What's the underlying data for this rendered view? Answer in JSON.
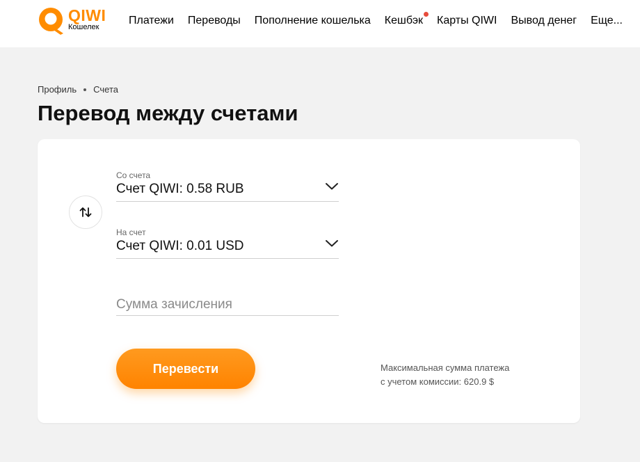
{
  "header": {
    "logo": {
      "brand": "QIWI",
      "subtitle": "Кошелек"
    },
    "nav": [
      {
        "label": "Платежи",
        "has_dot": false
      },
      {
        "label": "Переводы",
        "has_dot": false
      },
      {
        "label": "Пополнение кошелька",
        "has_dot": false
      },
      {
        "label": "Кешбэк",
        "has_dot": true
      },
      {
        "label": "Карты QIWI",
        "has_dot": false
      },
      {
        "label": "Вывод денег",
        "has_dot": false
      },
      {
        "label": "Еще...",
        "has_dot": false
      }
    ],
    "notification_dot_color": "#e74c3c"
  },
  "breadcrumb": {
    "items": [
      "Профиль",
      "Счета"
    ]
  },
  "page": {
    "title": "Перевод между счетами"
  },
  "form": {
    "from": {
      "label": "Со счета",
      "value": "Счет QIWI: 0.58 RUB",
      "icon": "chevron-down-icon"
    },
    "to": {
      "label": "На счет",
      "value": "Счет QIWI: 0.01 USD",
      "icon": "chevron-down-icon"
    },
    "swap_icon": "swap-arrows-icon",
    "amount": {
      "placeholder": "Сумма зачисления",
      "value": ""
    },
    "submit_label": "Перевести",
    "max_note_line1": "Максимальная сумма платежа",
    "max_note_line2": "с учетом комиссии: 620.9 $"
  },
  "colors": {
    "accent": "#ff8c00",
    "background": "#f2f2f2",
    "card": "#ffffff"
  }
}
